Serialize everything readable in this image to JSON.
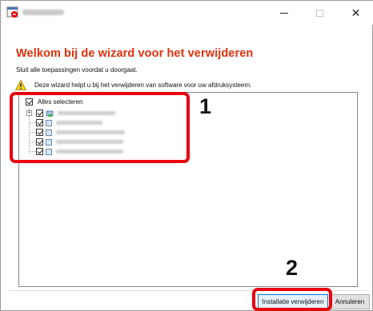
{
  "window": {
    "title": "",
    "minimize_glyph": "—",
    "close_glyph": "✕"
  },
  "wizard": {
    "heading": "Welkom bij de wizard voor het verwijderen",
    "subtext": "Sluit alle toepassingen voordat u doorgaat.",
    "info_text": "Deze wizard helpt u bij het verwijderen van software voor uw afdruksysteem."
  },
  "tree": {
    "select_all_label": "Alles selecteren",
    "items": [
      {
        "label": "",
        "checked": true,
        "expandable": true
      },
      {
        "label": "",
        "checked": true
      },
      {
        "label": "",
        "checked": true
      },
      {
        "label": "",
        "checked": true
      },
      {
        "label": "",
        "checked": true
      }
    ]
  },
  "annotations": {
    "callout_1": "1",
    "callout_2": "2"
  },
  "buttons": {
    "uninstall_label": "Installatie verwijderen",
    "cancel_label": "Annuleren"
  },
  "colors": {
    "heading": "#e0300b",
    "callout": "#e8000e",
    "primary_border": "#0078d7"
  },
  "icons": {
    "app": "uninstall-app-icon",
    "info": "warning-info-icon",
    "package": "package-icon"
  }
}
